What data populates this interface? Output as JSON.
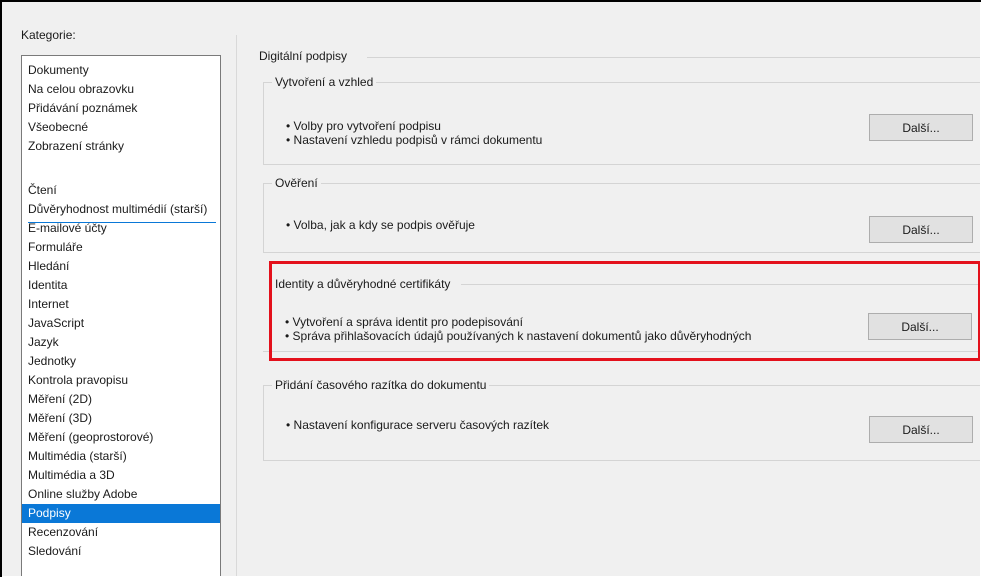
{
  "categories_label": "Kategorie:",
  "categories_top": [
    "Dokumenty",
    "Na celou obrazovku",
    "Přidávání poznámek",
    "Všeobecné",
    "Zobrazení stránky"
  ],
  "categories_bottom": [
    "Čtení",
    "Důvěryhodnost multimédií (starší)",
    "E-mailové účty",
    "Formuláře",
    "Hledání",
    "Identita",
    "Internet",
    "JavaScript",
    "Jazyk",
    "Jednotky",
    "Kontrola pravopisu",
    "Měření (2D)",
    "Měření (3D)",
    "Měření (geoprostorové)",
    "Multimédia (starší)",
    "Multimédia a 3D",
    "Online služby Adobe",
    "Podpisy",
    "Recenzování",
    "Sledování"
  ],
  "selected_category": "Podpisy",
  "page_title": "Digitální podpisy",
  "groups": [
    {
      "title": "Vytvoření a vzhled",
      "bullets": [
        "• Volby pro vytvoření podpisu",
        "• Nastavení vzhledu podpisů v rámci dokumentu"
      ],
      "button": "Další..."
    },
    {
      "title": "Ověření",
      "bullets": [
        "• Volba, jak a kdy se podpis ověřuje"
      ],
      "button": "Další..."
    },
    {
      "title": "Identity a důvěryhodné certifikáty",
      "bullets": [
        "• Vytvoření a správa identit pro podepisování",
        "• Správa přihlašovacích údajů používaných k nastavení dokumentů jako důvěryhodných"
      ],
      "button": "Další..."
    },
    {
      "title": "Přidání časového razítka do dokumentu",
      "bullets": [
        "• Nastavení konfigurace serveru časových razítek"
      ],
      "button": "Další..."
    }
  ],
  "colors": {
    "selection": "#0a78d7",
    "highlight": "#e3101b",
    "dialog_bg": "#f0f0f0"
  }
}
